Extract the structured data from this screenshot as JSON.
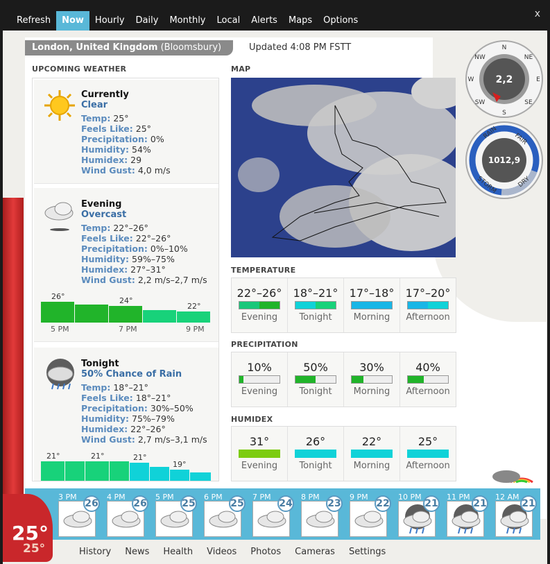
{
  "tabs": [
    "Refresh",
    "Now",
    "Hourly",
    "Daily",
    "Monthly",
    "Local",
    "Alerts",
    "Maps",
    "Options"
  ],
  "active_tab": "Now",
  "close": "x",
  "location": {
    "city": "London, United Kingdom",
    "area": "(Bloomsbury)"
  },
  "updated": "Updated 4:08 PM FSTT",
  "sections": {
    "upcoming": "UPCOMING WEATHER",
    "map": "MAP",
    "temperature": "TEMPERATURE",
    "precipitation": "PRECIPITATION",
    "humidex": "HUMIDEX"
  },
  "current": {
    "title": "Currently",
    "cond": "Clear",
    "rows": [
      [
        "Temp:",
        "25°"
      ],
      [
        "Feels Like:",
        "25°"
      ],
      [
        "Precipitation:",
        "0%"
      ],
      [
        "Humidity:",
        "54%"
      ],
      [
        "Humidex:",
        "29"
      ],
      [
        "Wind Gust:",
        "4,0 m/s"
      ]
    ]
  },
  "evening": {
    "title": "Evening",
    "cond": "Overcast",
    "rows": [
      [
        "Temp:",
        "22°–26°"
      ],
      [
        "Feels Like:",
        "22°–26°"
      ],
      [
        "Precipitation:",
        "0%–10%"
      ],
      [
        "Humidity:",
        "59%–75%"
      ],
      [
        "Humidex:",
        "27°–31°"
      ],
      [
        "Wind Gust:",
        "2,2 m/s–2,7 m/s"
      ]
    ],
    "chart_labels": [
      "26°",
      "24°",
      "22°"
    ],
    "chart_times": [
      "5 PM",
      "7 PM",
      "9 PM"
    ]
  },
  "tonight": {
    "title": "Tonight",
    "cond": "50% Chance of Rain",
    "rows": [
      [
        "Temp:",
        "18°–21°"
      ],
      [
        "Feels Like:",
        "18°–21°"
      ],
      [
        "Precipitation:",
        "30%–50%"
      ],
      [
        "Humidity:",
        "75%–79%"
      ],
      [
        "Humidex:",
        "22°–26°"
      ],
      [
        "Wind Gust:",
        "2,7 m/s–3,1 m/s"
      ]
    ],
    "chart_labels": [
      "21°",
      "21°",
      "21°",
      "19°"
    ]
  },
  "temperature": [
    {
      "v": "22°–26°",
      "l": "Evening"
    },
    {
      "v": "18°–21°",
      "l": "Tonight"
    },
    {
      "v": "17°–18°",
      "l": "Morning"
    },
    {
      "v": "17°–20°",
      "l": "Afternoon"
    }
  ],
  "precipitation": [
    {
      "v": "10%",
      "l": "Evening",
      "p": 0.1
    },
    {
      "v": "50%",
      "l": "Tonight",
      "p": 0.5
    },
    {
      "v": "30%",
      "l": "Morning",
      "p": 0.3
    },
    {
      "v": "40%",
      "l": "Afternoon",
      "p": 0.4
    }
  ],
  "humidex": [
    {
      "v": "31°",
      "l": "Evening"
    },
    {
      "v": "26°",
      "l": "Tonight"
    },
    {
      "v": "22°",
      "l": "Morning"
    },
    {
      "v": "25°",
      "l": "Afternoon"
    }
  ],
  "wind": {
    "value": "2,2",
    "n": "N",
    "ne": "NE",
    "e": "E",
    "se": "SE",
    "s": "S",
    "sw": "SW",
    "w": "W",
    "nw": "NW"
  },
  "pressure": {
    "value": "1012,9",
    "rain": "RAIN",
    "fair": "FAIR",
    "storm": "STORM",
    "dry": "DRY"
  },
  "hours": [
    {
      "t": "3 PM",
      "n": "26"
    },
    {
      "t": "4 PM",
      "n": "26"
    },
    {
      "t": "5 PM",
      "n": "25"
    },
    {
      "t": "6 PM",
      "n": "25"
    },
    {
      "t": "7 PM",
      "n": "24"
    },
    {
      "t": "8 PM",
      "n": "23"
    },
    {
      "t": "9 PM",
      "n": "22"
    },
    {
      "t": "10 PM",
      "n": "21"
    },
    {
      "t": "11 PM",
      "n": "21"
    },
    {
      "t": "12 AM",
      "n": "21"
    }
  ],
  "bottom_links": [
    "History",
    "News",
    "Health",
    "Videos",
    "Photos",
    "Cameras",
    "Settings"
  ],
  "thermo": {
    "big": "25°",
    "small": "25°"
  }
}
